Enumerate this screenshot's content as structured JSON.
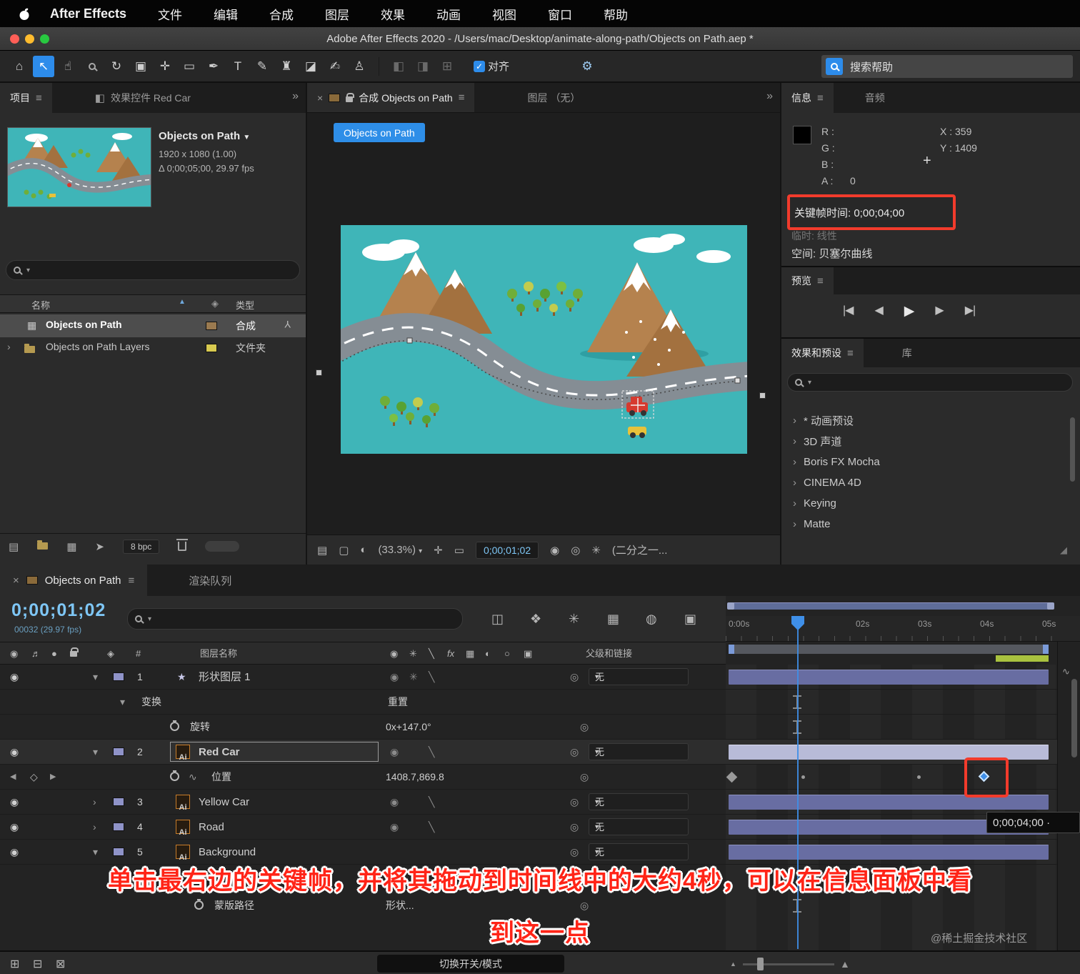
{
  "colors": {
    "accent_blue": "#2d8ceb",
    "highlight_red": "#f23b2c",
    "timecode_blue": "#7ec6f5",
    "value_blue": "#6fa8dc",
    "canvas_teal": "#3fb5b8",
    "layer_bar": "#686da2",
    "selected_layer_bar": "#b8bbd8",
    "annotation_red": "#ff2417"
  },
  "icons": {
    "menu": "≡",
    "expand": "»",
    "close": "×",
    "chevron_down": "▾",
    "caret_down": "▼",
    "chevron_right": "›",
    "sort_asc": "▲",
    "home": "⌂",
    "selection": "↖",
    "hand": "☝",
    "orbit": "↻",
    "camera": "▣",
    "pan_behind": "✛",
    "rect_tool": "▭",
    "pen": "✒",
    "type": "T",
    "brush": "✎",
    "stamp": "♜",
    "eraser": "◪",
    "roto_brush": "✍",
    "puppet_pin": "♙",
    "workspace_a": "◧",
    "workspace_b": "◨",
    "workspace_c": "⊞",
    "gear": "⚙",
    "eye": "◉",
    "audio": "♬",
    "solo": "●",
    "tag": "◈",
    "star": "★",
    "switch_a": "◉",
    "switch_b": "✳",
    "switch_c": "╲",
    "switch_fx": "fx",
    "switch_grid": "▦",
    "switch_half": "◐",
    "switch_circle": "○",
    "switch_box": "▣",
    "pickwhip": "◎",
    "nav_prev": "◀",
    "nav_kf": "◇",
    "nav_next": "▶",
    "graph": "∿",
    "tl_flow": "◫",
    "tl_blur": "✳",
    "tl_3d": "❖",
    "tl_film": "▦",
    "tl_motion": "◍",
    "tl_graph": "▣",
    "view_layout": "▤",
    "view_monitor": "▢",
    "view_channels": "◐",
    "view_target": "✛",
    "view_roi": "▭",
    "snapshot": "◉",
    "show_snapshot": "◎",
    "color_wheel": "✳",
    "pb_start": "|◀",
    "pb_prev": "◀",
    "pb_play": "▶",
    "pb_next": "▶",
    "pb_end": "▶|",
    "comp_icon": "▦",
    "branch": "Y",
    "resize": "◢",
    "bin_list": "▤",
    "bin_grid": "▦",
    "bin_send": "➤",
    "bottom_a": "⊞",
    "bottom_b": "⊟",
    "bottom_c": "⊠",
    "zoom_out": "▲",
    "zoom_in": "▲",
    "hash": "#",
    "plus": "+"
  },
  "menu_bar": {
    "app_name": "After Effects",
    "items": [
      "文件",
      "编辑",
      "合成",
      "图层",
      "效果",
      "动画",
      "视图",
      "窗口",
      "帮助"
    ]
  },
  "title_bar": {
    "title": "Adobe After Effects 2020 - /Users/mac/Desktop/animate-along-path/Objects on Path.aep *"
  },
  "toolbar": {
    "align_label": "对齐",
    "search_placeholder": "搜索帮助"
  },
  "project": {
    "tab_project": "项目",
    "tab_effect_controls": "效果控件 Red Car",
    "comp_name": "Objects on Path",
    "comp_dims": "1920 x 1080 (1.00)",
    "comp_time": "Δ 0;00;05;00, 29.97 fps",
    "header_name": "名称",
    "header_type": "类型",
    "rows": [
      {
        "name": "Objects on Path",
        "type": "合成"
      },
      {
        "name": "Objects on Path Layers",
        "type": "文件夹"
      }
    ],
    "bpc": "8 bpc"
  },
  "viewer": {
    "tab_comp": "合成 Objects on Path",
    "tab_layer": "图层 （无）",
    "comp_button": "Objects on Path",
    "zoom": "(33.3%)",
    "timecode": "0;00;01;02",
    "resolution": "(二分之一..."
  },
  "info": {
    "tab_info": "信息",
    "tab_audio": "音频",
    "r_label": "R :",
    "g_label": "G :",
    "b_label": "B :",
    "a_label": "A :",
    "a_value": "0",
    "x_value": "X : 359",
    "y_value": "Y : 1409",
    "keyframe_time": "关键帧时间: 0;00;04;00",
    "temporal": "临时: 线性",
    "spatial": "空间: 贝塞尔曲线"
  },
  "preview": {
    "title": "预览"
  },
  "effects": {
    "tab_effects": "效果和预设",
    "tab_library": "库",
    "items": [
      "* 动画预设",
      "3D 声道",
      "Boris FX Mocha",
      "CINEMA 4D",
      "Keying",
      "Matte"
    ]
  },
  "timeline": {
    "tab_comp": "Objects on Path",
    "tab_render": "渲染队列",
    "timecode": "0;00;01;02",
    "frame_info": "00032 (29.97 fps)",
    "header_number": "#",
    "header_layer_name": "图层名称",
    "header_parent": "父级和链接",
    "ruler_ticks": [
      "0:00s",
      "02s",
      "03s",
      "04s",
      "05s"
    ],
    "none_label": "无",
    "layers": [
      {
        "num": "1",
        "name": "形状图层 1"
      },
      {
        "num": "2",
        "name": "Red Car"
      },
      {
        "num": "3",
        "name": "Yellow Car"
      },
      {
        "num": "4",
        "name": "Road"
      },
      {
        "num": "5",
        "name": "Background"
      }
    ],
    "props": {
      "transform": "变换",
      "reset": "重置",
      "rotation": "旋转",
      "rotation_value": "0x+147.0°",
      "position": "位置",
      "position_value": "1408.7,869.8",
      "mask_path": "蒙版路径",
      "mask_path_value": "形状..."
    },
    "keyframe_tooltip": "0;00;04;00 ·",
    "toggle_button": "切换开关/模式"
  },
  "annotation": {
    "line1": "单击最右边的关键帧，并将其拖动到时间线中的大约4秒，可以在信息面板中看",
    "line2": "到这一点",
    "watermark": "@稀土掘金技术社区"
  }
}
